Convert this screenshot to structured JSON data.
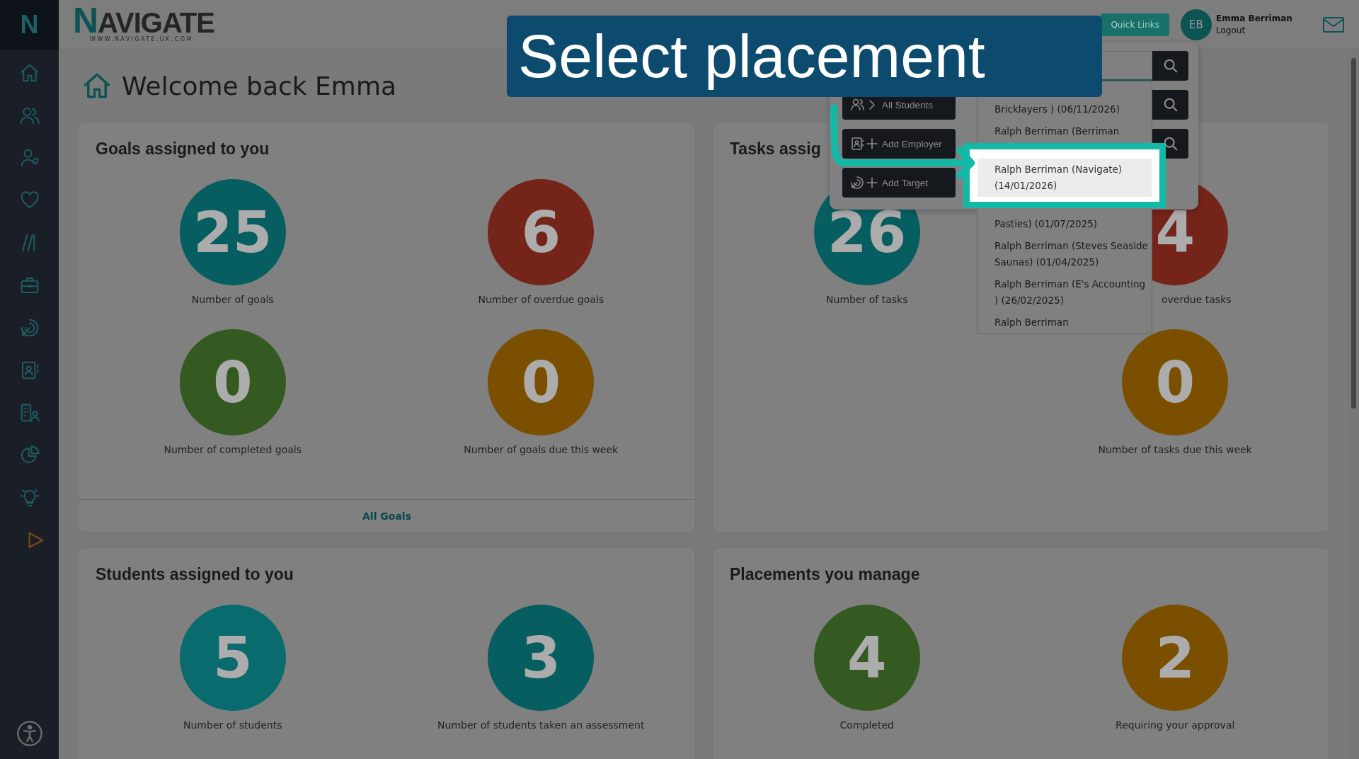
{
  "caption": "Select placement",
  "sidebar": {
    "brand": "N"
  },
  "header": {
    "logo": "NAVIGATE",
    "tagline": "WWW.NAVIGATE.UK.COM",
    "quick_links": "Quick Links",
    "user": {
      "initials": "EB",
      "name": "Emma Berriman",
      "link": "Logout"
    }
  },
  "page_title": "Welcome back Emma",
  "cards": [
    {
      "title": "Goals assigned to you",
      "stats": [
        {
          "kind": "stat",
          "value": "25",
          "label": "Number of goals",
          "color": "#075e60"
        },
        {
          "kind": "stat",
          "value": "6",
          "label": "Number of overdue goals",
          "color": "#742419"
        },
        {
          "kind": "stat",
          "value": "0",
          "label": "Number of completed goals",
          "color": "#345a21"
        },
        {
          "kind": "stat",
          "value": "0",
          "label": "Number of goals due this week",
          "color": "#7a5000"
        }
      ],
      "footer_link": "All Goals"
    },
    {
      "title": "Tasks assig",
      "stats": [
        {
          "kind": "stat",
          "value": "26",
          "label": "Number of tasks",
          "color": "#075e60"
        },
        {
          "kind": "stat",
          "value": "4",
          "label": "overdue tasks",
          "color": "#742419"
        },
        {
          "kind": "gap"
        },
        {
          "kind": "stat",
          "value": "0",
          "label": "Number of tasks due this week",
          "color": "#7a5000"
        }
      ]
    },
    {
      "title": "Students assigned to you",
      "stats": [
        {
          "kind": "stat",
          "value": "5",
          "label": "Number of students",
          "color": "#0a6b6e"
        },
        {
          "kind": "stat",
          "value": "3",
          "label": "Number of students taken an assessment",
          "color": "#075e60"
        }
      ]
    },
    {
      "title": "Placements you manage",
      "stats": [
        {
          "kind": "stat",
          "value": "4",
          "label": "Completed",
          "color": "#345a21"
        },
        {
          "kind": "stat",
          "value": "2",
          "label": "Requiring your approval",
          "color": "#7a5000"
        }
      ]
    }
  ],
  "quick_links_menu": {
    "buttons": [
      {
        "kind": "students",
        "label": "All Students"
      },
      {
        "kind": "employer",
        "label": "Add Employer"
      },
      {
        "kind": "target",
        "label": "Add Target"
      }
    ],
    "dropdown": [
      {
        "lines": [
          "Bricklayers ) (06/11/2026)"
        ],
        "selected": false
      },
      {
        "lines": [
          "Ralph Berriman (Berriman"
        ],
        "selected": false
      },
      {
        "lines": [
          "Ralph Berriman (Navigate)",
          "(14/01/2026)"
        ],
        "selected": true
      },
      {
        "lines": [
          "Pasties) (01/07/2025)"
        ],
        "selected": false
      },
      {
        "lines": [
          "Ralph Berriman (Steves Seaside",
          "Saunas) (01/04/2025)"
        ],
        "selected": false
      },
      {
        "lines": [
          "Ralph Berriman (E's Accounting",
          ") (26/02/2025)"
        ],
        "selected": false
      },
      {
        "lines": [
          "Ralph Berriman"
        ],
        "selected": false
      }
    ]
  }
}
